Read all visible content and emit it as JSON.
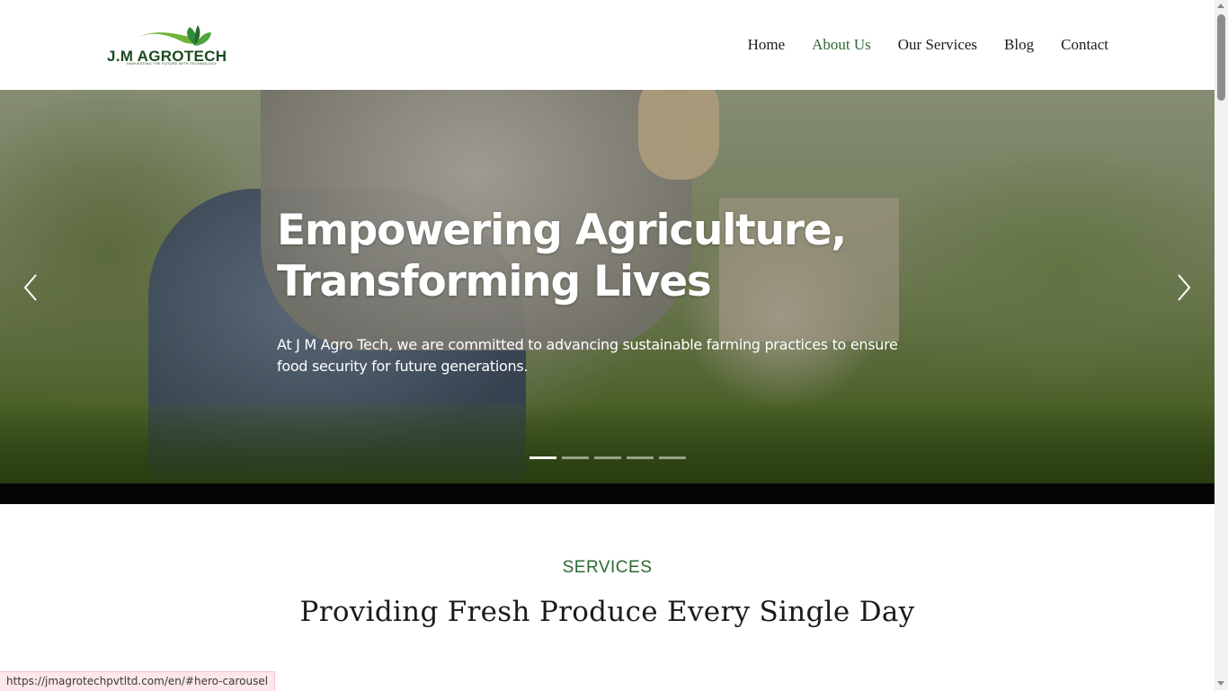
{
  "browser": {
    "status_url": "https://jmagrotechpvtltd.com/en/#hero-carousel",
    "page_load_progress": 0.2
  },
  "header": {
    "logo_text": "J.M AGROTECH",
    "logo_tagline": "HARVESTING THE FUTURE WITH TECHNOLOGY",
    "nav": [
      {
        "label": "Home",
        "active": false
      },
      {
        "label": "About Us",
        "active": true
      },
      {
        "label": "Our Services",
        "active": false
      },
      {
        "label": "Blog",
        "active": false
      },
      {
        "label": "Contact",
        "active": false
      }
    ]
  },
  "hero": {
    "title": "Empowering Agriculture, Transforming Lives",
    "text": "At J M Agro Tech, we are committed to advancing sustainable farming practices to ensure food security for future generations.",
    "slide_count": 5,
    "active_slide": 1,
    "prev_icon": "chevron-left-icon",
    "next_icon": "chevron-right-icon"
  },
  "services": {
    "label": "SERVICES",
    "title": "Providing Fresh Produce Every Single Day"
  },
  "colors": {
    "brand_green": "#2b6a33",
    "logo_dark_green": "#1c4a1e",
    "progress_blue": "#1f6fc5",
    "status_bg": "#fde7e9"
  }
}
